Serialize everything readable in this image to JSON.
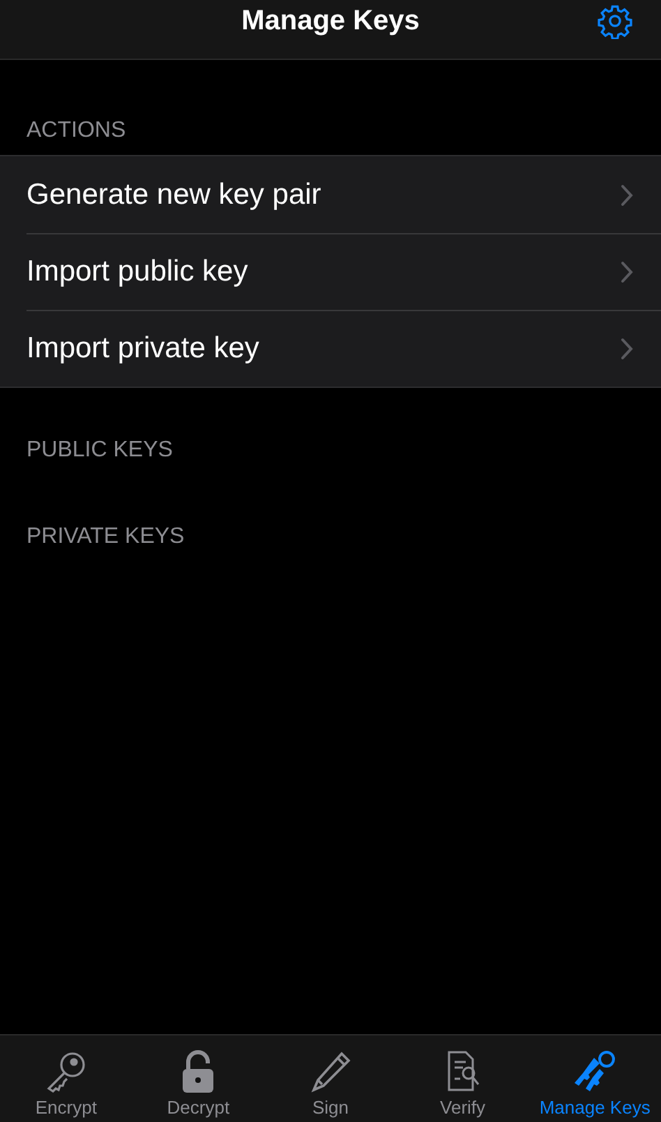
{
  "nav_bar": {
    "title": "Manage Keys"
  },
  "sections": [
    {
      "header": "ACTIONS",
      "items": [
        {
          "label": "Generate new key pair"
        },
        {
          "label": "Import public key"
        },
        {
          "label": "Import private key"
        }
      ]
    },
    {
      "header": "PUBLIC KEYS"
    },
    {
      "header": "PRIVATE KEYS"
    }
  ],
  "tab_bar": [
    {
      "label": "Encrypt",
      "kind": "key",
      "selected": false
    },
    {
      "label": "Decrypt",
      "kind": "lock",
      "selected": false
    },
    {
      "label": "Sign",
      "kind": "pencil",
      "selected": false
    },
    {
      "label": "Verify",
      "kind": "document",
      "selected": false
    },
    {
      "label": "Manage Keys",
      "kind": "keys",
      "selected": true
    }
  ]
}
